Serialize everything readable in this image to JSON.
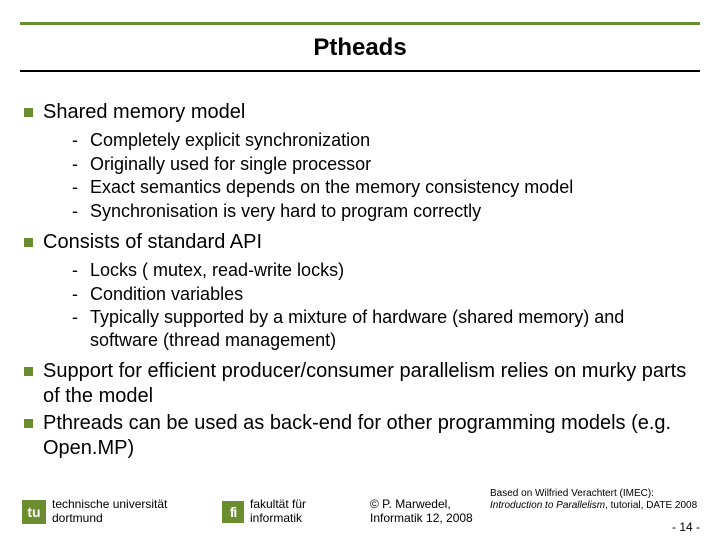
{
  "title": "Ptheads",
  "bullets": {
    "b0": {
      "text": "Shared memory model",
      "sub": [
        "Completely explicit synchronization",
        "Originally used for single processor",
        "Exact semantics depends on the memory consistency model",
        "Synchronisation is very hard to program correctly"
      ]
    },
    "b1": {
      "text": "Consists of standard API",
      "sub": [
        "Locks ( mutex, read-write locks)",
        "Condition variables",
        "Typically supported by a mixture of hardware (shared memory) and software (thread management)"
      ]
    },
    "b2": {
      "text": "Support for efficient producer/consumer parallelism relies on murky parts of the model"
    },
    "b3": {
      "text": "Pthreads can be used as back-end for other programming models (e.g. Open.MP)"
    }
  },
  "footer": {
    "tu_mark": "tu",
    "tu_line1": "technische universität",
    "tu_line2": "dortmund",
    "fi_mark": "fi",
    "fi_line1": "fakultät für",
    "fi_line2": "informatik",
    "copy_line1": "© P. Marwedel,",
    "copy_line2": "Informatik 12,  2008",
    "ref_prefix": "Based on Wilfried Verachtert (IMEC): ",
    "ref_italic": "Introduction to Parallelism",
    "ref_suffix": ", tutorial,  DATE 2008",
    "pagenum": "-  14 -"
  },
  "dash": "-"
}
